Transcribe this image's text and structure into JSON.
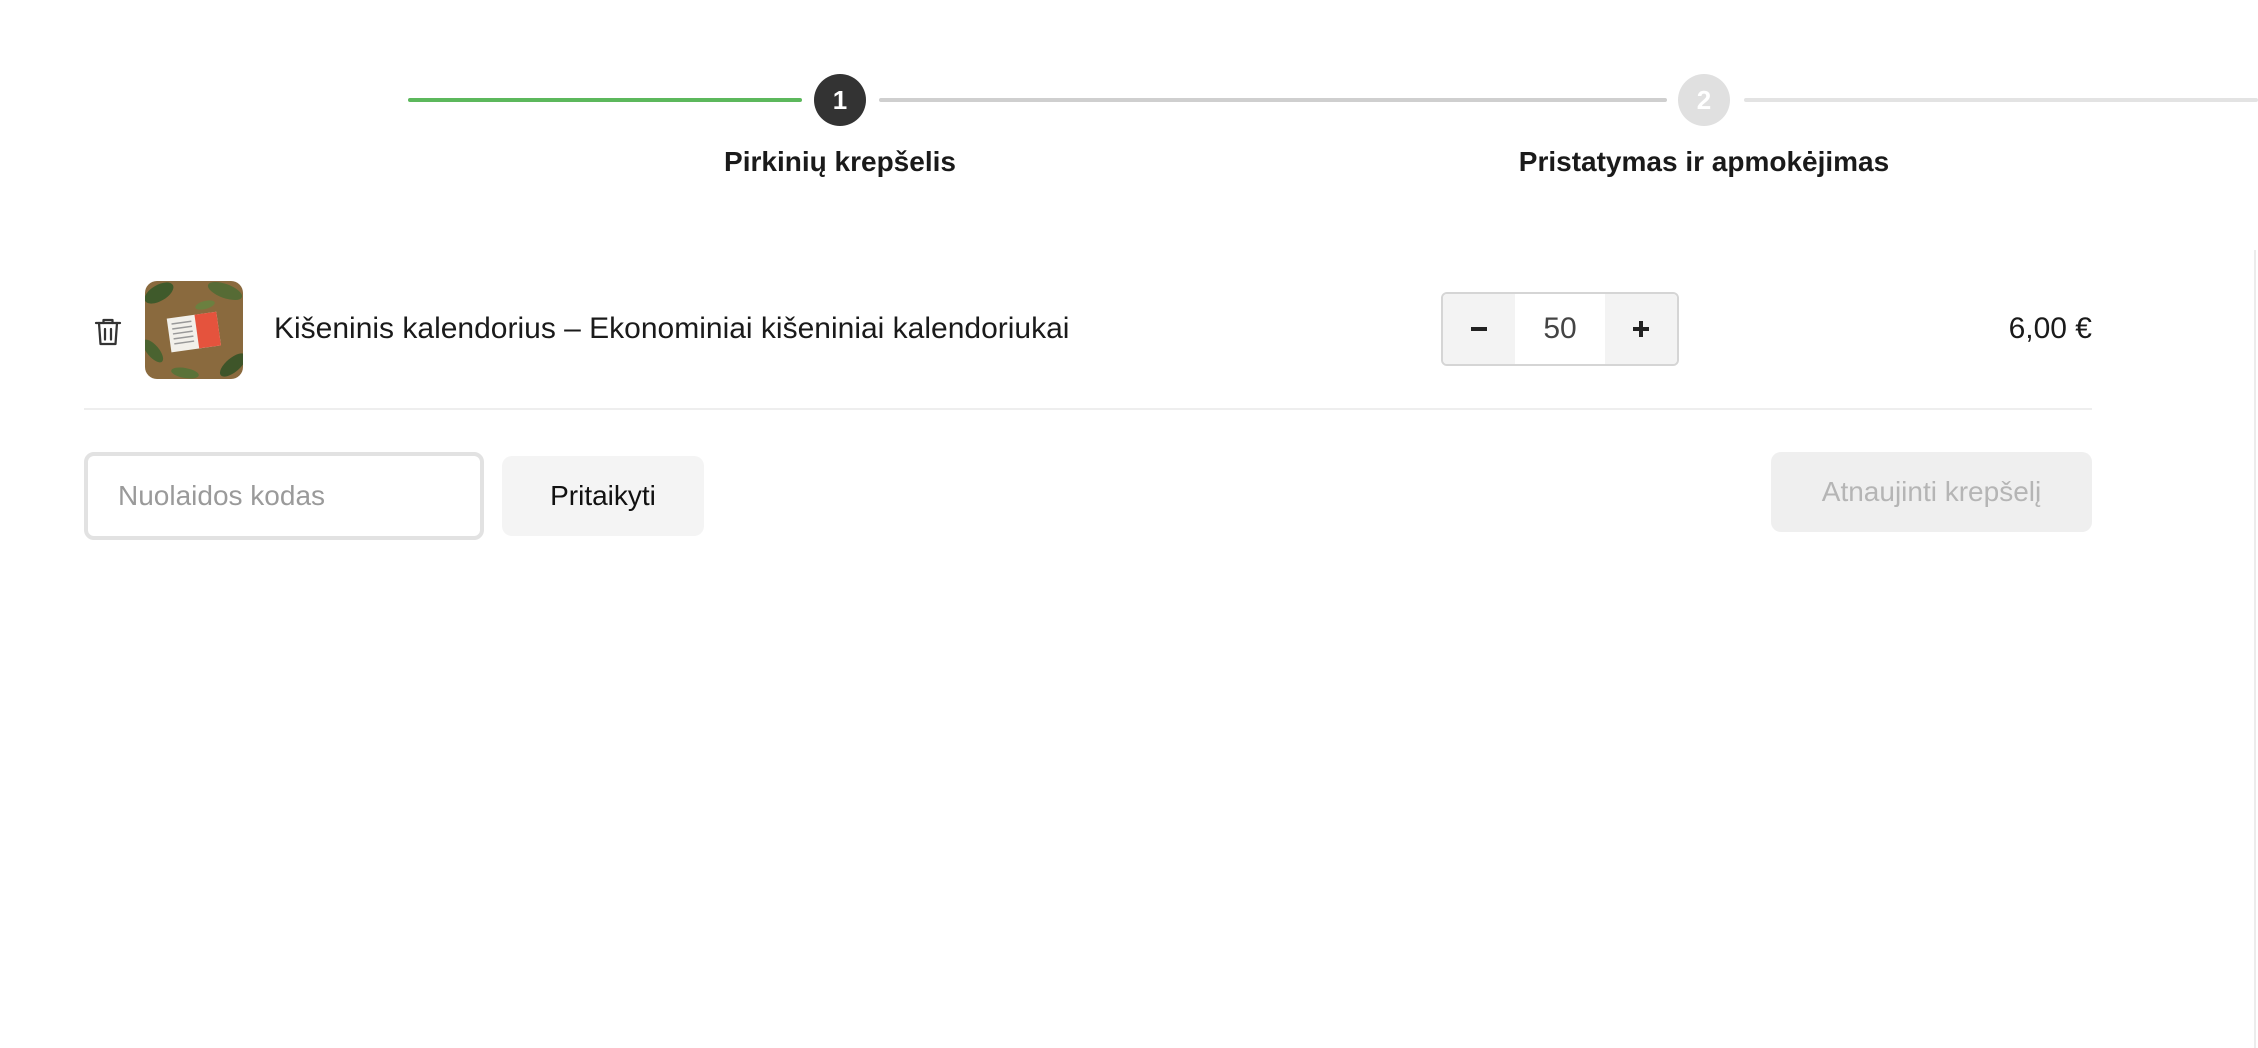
{
  "stepper": {
    "steps": [
      {
        "number": "1",
        "label": "Pirkinių krepšelis",
        "state": "active"
      },
      {
        "number": "2",
        "label": "Pristatymas ir apmokėjimas",
        "state": "inactive"
      }
    ],
    "progress_color": "#5cb85c"
  },
  "cart": {
    "items": [
      {
        "name": "Kišeninis kalendorius – Ekonominiai kišeniniai kalendoriukai",
        "quantity": "50",
        "price": "6,00 €",
        "remove_icon": "trash-icon",
        "image": "product-thumbnail"
      }
    ]
  },
  "coupon": {
    "placeholder": "Nuolaidos kodas",
    "apply_label": "Pritaikyti"
  },
  "update_cart_label": "Atnaujinti krepšelį"
}
